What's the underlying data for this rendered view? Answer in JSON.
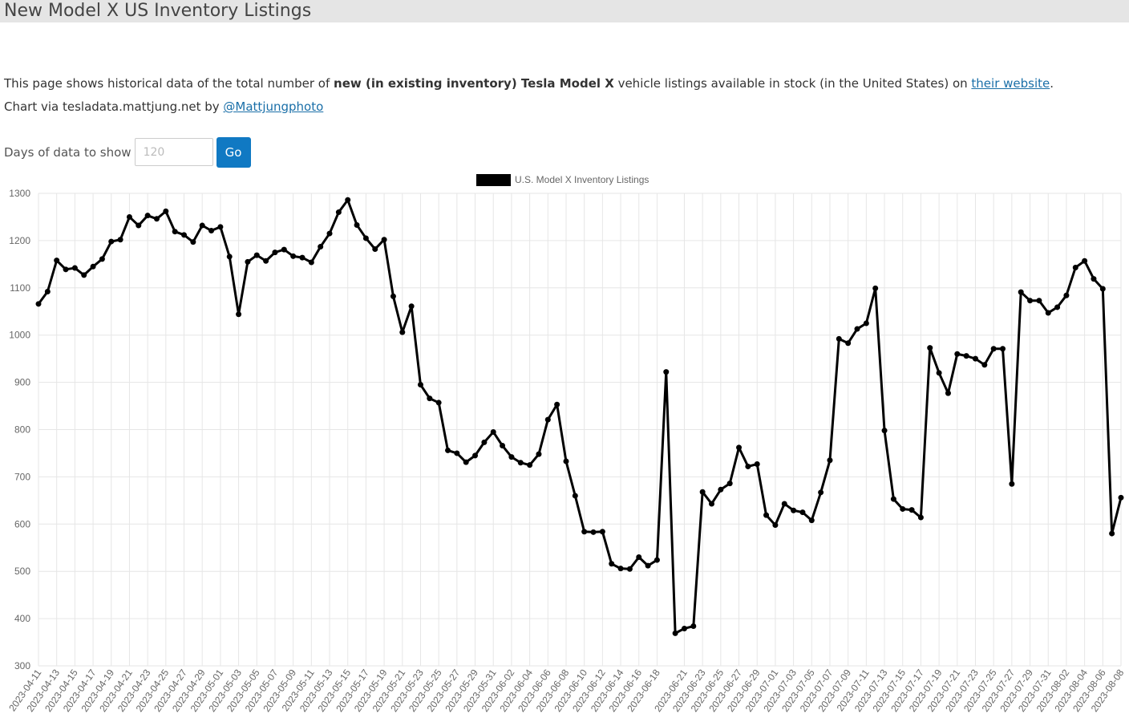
{
  "page": {
    "title": "New Model X US Inventory Listings",
    "intro": {
      "prefix": "This page shows historical data of the total number of ",
      "bold": "new (in existing inventory) Tesla Model X",
      "middle": " vehicle listings available in stock (in the United States) on ",
      "link": "their website",
      "suffix": "."
    },
    "credit": {
      "prefix": "Chart via tesladata.mattjung.net by ",
      "link": "@Mattjungphoto"
    },
    "days_form": {
      "label": "Days of data to show",
      "placeholder": "120",
      "button": "Go"
    }
  },
  "colors": {
    "button": "#1079c3",
    "link": "#1a6fa8",
    "series": "#000000",
    "grid": "#e6e6e6"
  },
  "chart_data": {
    "type": "line",
    "title": "",
    "xlabel": "",
    "ylabel": "",
    "legend_position": "top-center",
    "grid": true,
    "ylim": [
      300,
      1300
    ],
    "yticks": [
      300,
      400,
      500,
      600,
      700,
      800,
      900,
      1000,
      1100,
      1200,
      1300
    ],
    "x_start": "2023-04-11",
    "tick_labels": [
      "2023-04-11",
      "2023-04-13",
      "2023-04-15",
      "2023-04-17",
      "2023-04-19",
      "2023-04-21",
      "2023-04-23",
      "2023-04-25",
      "2023-04-27",
      "2023-04-29",
      "2023-05-01",
      "2023-05-03",
      "2023-05-05",
      "2023-05-07",
      "2023-05-09",
      "2023-05-11",
      "2023-05-13",
      "2023-05-15",
      "2023-05-17",
      "2023-05-19",
      "2023-05-21",
      "2023-05-23",
      "2023-05-25",
      "2023-05-27",
      "2023-05-29",
      "2023-05-31",
      "2023-06-02",
      "2023-06-04",
      "2023-06-06",
      "2023-06-08",
      "2023-06-10",
      "2023-06-12",
      "2023-06-14",
      "2023-06-16",
      "2023-06-18",
      "2023-06-21",
      "2023-06-23",
      "2023-06-25",
      "2023-06-27",
      "2023-06-29",
      "2023-07-01",
      "2023-07-03",
      "2023-07-05",
      "2023-07-07",
      "2023-07-09",
      "2023-07-11",
      "2023-07-13",
      "2023-07-15",
      "2023-07-17",
      "2023-07-19",
      "2023-07-21",
      "2023-07-23",
      "2023-07-25",
      "2023-07-27",
      "2023-07-29",
      "2023-07-31",
      "2023-08-02",
      "2023-08-04",
      "2023-08-06",
      "2023-08-08"
    ],
    "series": [
      {
        "name": "U.S. Model X Inventory Listings",
        "values": [
          1066,
          1092,
          1158,
          1139,
          1142,
          1127,
          1145,
          1161,
          1198,
          1202,
          1250,
          1232,
          1253,
          1246,
          1262,
          1219,
          1212,
          1197,
          1232,
          1221,
          1229,
          1166,
          1044,
          1155,
          1169,
          1157,
          1175,
          1181,
          1167,
          1164,
          1154,
          1187,
          1215,
          1260,
          1286,
          1233,
          1205,
          1182,
          1202,
          1082,
          1006,
          1061,
          895,
          866,
          857,
          756,
          750,
          731,
          745,
          773,
          795,
          766,
          742,
          730,
          725,
          748,
          821,
          853,
          733,
          660,
          584,
          583,
          584,
          516,
          506,
          505,
          530,
          512,
          524,
          922,
          369,
          379,
          384,
          668,
          643,
          673,
          686,
          762,
          722,
          727,
          619,
          598,
          643,
          629,
          625,
          608,
          667,
          735,
          992,
          983,
          1013,
          1025,
          1099,
          798,
          653,
          632,
          630,
          614,
          973,
          920,
          877,
          960,
          956,
          950,
          937,
          971,
          971,
          685,
          1091,
          1073,
          1073,
          1047,
          1059,
          1084,
          1143,
          1157,
          1119,
          1098,
          580,
          656
        ]
      }
    ]
  }
}
